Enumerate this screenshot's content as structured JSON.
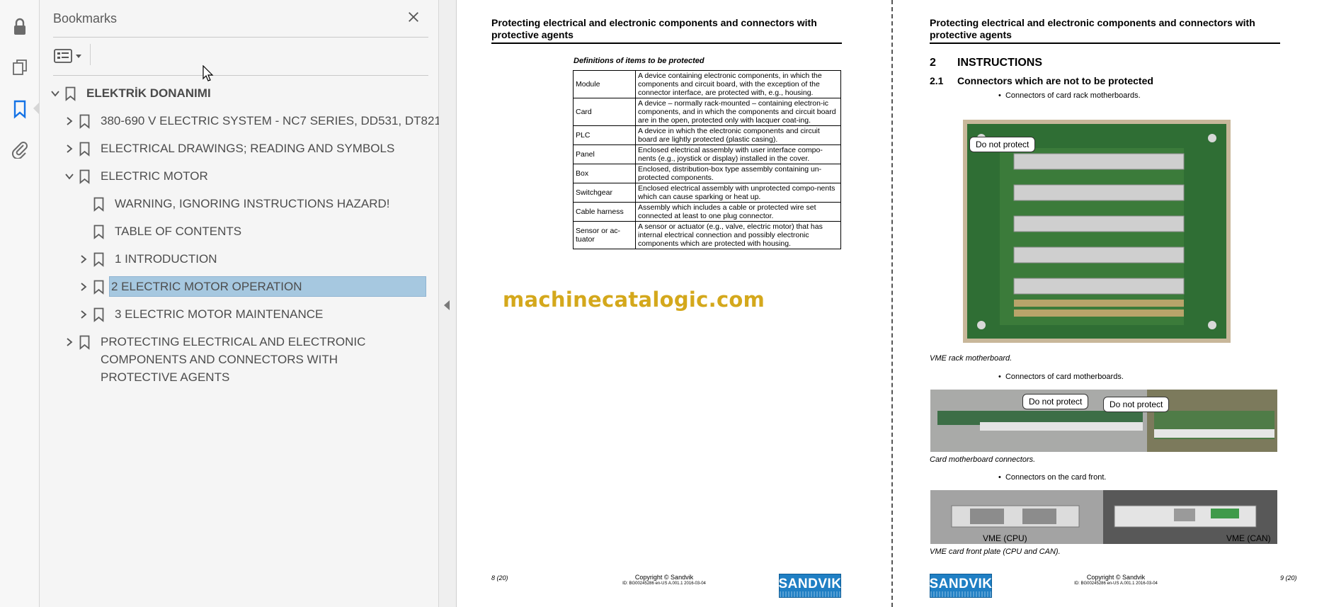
{
  "rail": {
    "icons": [
      "lock-icon",
      "pages-icon",
      "bookmark-icon",
      "attachment-icon"
    ],
    "active": "bookmark-icon"
  },
  "bookmarks_panel": {
    "title": "Bookmarks",
    "items": [
      {
        "label": "ELEKTRİK DONANIMI",
        "state": "expanded",
        "bold": true
      },
      {
        "label": "380-690 V ELECTRIC SYSTEM - NC7 SERIES, DD531, DT821",
        "state": "collapsed"
      },
      {
        "label": "ELECTRICAL DRAWINGS; READING AND SYMBOLS",
        "state": "collapsed"
      },
      {
        "label": "ELECTRIC MOTOR",
        "state": "expanded"
      },
      {
        "label": "WARNING, IGNORING INSTRUCTIONS HAZARD!",
        "state": "leaf"
      },
      {
        "label": "TABLE OF CONTENTS",
        "state": "leaf"
      },
      {
        "label": "1 INTRODUCTION",
        "state": "collapsed"
      },
      {
        "label": "2 ELECTRIC MOTOR OPERATION",
        "state": "collapsed",
        "selected": true
      },
      {
        "label": "3 ELECTRIC MOTOR MAINTENANCE",
        "state": "collapsed"
      },
      {
        "label": "PROTECTING ELECTRICAL AND ELECTRONIC COMPONENTS AND CONNECTORS WITH PROTECTIVE AGENTS",
        "state": "collapsed"
      }
    ]
  },
  "page_left": {
    "header": "Protecting electrical and electronic components and connectors with protective agents",
    "definitions_title": "Definitions of items to be protected",
    "definitions": [
      {
        "term": "Module",
        "desc": "A device containing electronic components, in which the components and circuit board, with the exception of the connector interface, are protected with, e.g., housing."
      },
      {
        "term": "Card",
        "desc": "A device – normally rack-mounted – containing electron-ic components, and in which the components and circuit board are in the open, protected only with lacquer coat-ing."
      },
      {
        "term": "PLC",
        "desc": "A device in which the electronic components and circuit board are lightly protected (plastic casing)."
      },
      {
        "term": "Panel",
        "desc": "Enclosed electrical assembly with user interface compo-nents (e.g., joystick or display) installed in the cover."
      },
      {
        "term": "Box",
        "desc": "Enclosed, distribution-box type assembly containing un-protected components."
      },
      {
        "term": "Switchgear",
        "desc": "Enclosed electrical assembly with unprotected compo-nents which can cause sparking or heat up."
      },
      {
        "term": "Cable harness",
        "desc": "Assembly which includes a cable or protected wire set connected at least to one plug connector."
      },
      {
        "term": "Sensor or ac-tuator",
        "desc": "A sensor or actuator (e.g., valve, electric motor) that has internal electrical connection and possibly electronic components which are protected with housing."
      }
    ],
    "watermark": "machinecatalogic.com",
    "footer": {
      "page": "8 (20)",
      "copyright": "Copyright © Sandvik",
      "doc_id": "ID: BG00245286 en-US A.001.1 2016-03-04",
      "logo": "SANDVIK"
    }
  },
  "page_right": {
    "header": "Protecting electrical and electronic components and connectors with protective agents",
    "section": {
      "num": "2",
      "title": "INSTRUCTIONS"
    },
    "subsection": {
      "num": "2.1",
      "title": "Connectors which are not to be protected"
    },
    "bullets": [
      "Connectors of card rack motherboards.",
      "Connectors of card motherboards.",
      "Connectors on the card front."
    ],
    "callout": "Do not protect",
    "captions": [
      "VME rack motherboard.",
      "Card motherboard connectors.",
      "VME card front plate (CPU and CAN)."
    ],
    "photo_labels": [
      "VME (CPU)",
      "VME (CAN)"
    ],
    "footer": {
      "page": "9 (20)",
      "copyright": "Copyright © Sandvik",
      "doc_id": "ID: BG00245286 en-US A.001.1 2016-03-04",
      "logo": "SANDVIK"
    }
  }
}
